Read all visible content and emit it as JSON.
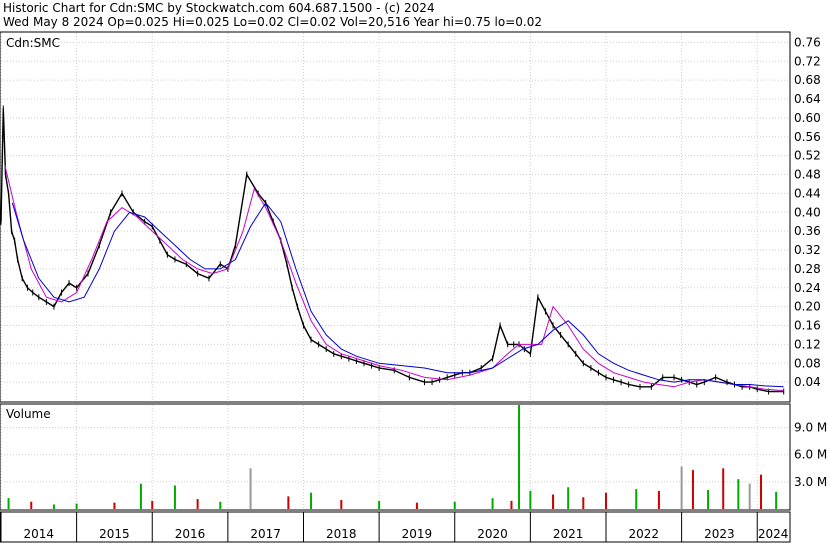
{
  "header": {
    "line1": "Historic Chart for Cdn:SMC by Stockwatch.com 604.687.1500 - (c) 2024",
    "line2": "Wed May  8 2024   Op=0.025  Hi=0.025  Lo=0.02  Cl=0.02  Vol=20,516  Year hi=0.75  lo=0.02"
  },
  "chart_data": [
    {
      "type": "line",
      "panel": "price",
      "title": "Cdn:SMC",
      "ylim": [
        0.0,
        0.78
      ],
      "yticks": [
        "0.76",
        "0.72",
        "0.68",
        "0.64",
        "0.60",
        "0.56",
        "0.52",
        "0.48",
        "0.44",
        "0.40",
        "0.36",
        "0.32",
        "0.28",
        "0.24",
        "0.20",
        "0.16",
        "0.12",
        "0.08",
        "0.04"
      ],
      "grid": true,
      "colors": {
        "price": "#000000",
        "ma_short": "#cc00cc",
        "ma_long": "#0000cc"
      },
      "series": [
        {
          "role": "price",
          "x": [
            2014.0,
            2014.03,
            2014.06,
            2014.1,
            2014.14,
            2014.18,
            2014.22,
            2014.28,
            2014.35,
            2014.42,
            2014.5,
            2014.6,
            2014.7,
            2014.8,
            2014.9,
            2015.0,
            2015.15,
            2015.3,
            2015.45,
            2015.6,
            2015.75,
            2015.9,
            2016.0,
            2016.1,
            2016.2,
            2016.3,
            2016.45,
            2016.6,
            2016.75,
            2016.9,
            2017.0,
            2017.1,
            2017.25,
            2017.4,
            2017.5,
            2017.6,
            2017.7,
            2017.78,
            2017.85,
            2017.92,
            2018.0,
            2018.1,
            2018.2,
            2018.3,
            2018.4,
            2018.5,
            2018.6,
            2018.7,
            2018.8,
            2018.9,
            2019.0,
            2019.2,
            2019.4,
            2019.6,
            2019.7,
            2019.8,
            2019.9,
            2020.0,
            2020.1,
            2020.2,
            2020.35,
            2020.5,
            2020.6,
            2020.7,
            2020.78,
            2020.85,
            2020.92,
            2021.0,
            2021.1,
            2021.2,
            2021.3,
            2021.4,
            2021.5,
            2021.6,
            2021.7,
            2021.8,
            2021.9,
            2022.0,
            2022.1,
            2022.2,
            2022.3,
            2022.45,
            2022.6,
            2022.75,
            2022.9,
            2023.0,
            2023.1,
            2023.2,
            2023.3,
            2023.45,
            2023.6,
            2023.7,
            2023.8,
            2023.9,
            2024.0,
            2024.15,
            2024.35
          ],
          "y": [
            0.38,
            0.62,
            0.48,
            0.44,
            0.36,
            0.34,
            0.3,
            0.26,
            0.24,
            0.23,
            0.22,
            0.21,
            0.2,
            0.23,
            0.25,
            0.24,
            0.27,
            0.33,
            0.4,
            0.44,
            0.4,
            0.38,
            0.37,
            0.34,
            0.31,
            0.3,
            0.29,
            0.27,
            0.26,
            0.29,
            0.28,
            0.33,
            0.48,
            0.44,
            0.42,
            0.38,
            0.34,
            0.29,
            0.24,
            0.2,
            0.16,
            0.13,
            0.12,
            0.11,
            0.1,
            0.095,
            0.09,
            0.085,
            0.08,
            0.075,
            0.07,
            0.065,
            0.05,
            0.04,
            0.04,
            0.045,
            0.05,
            0.055,
            0.06,
            0.06,
            0.07,
            0.09,
            0.16,
            0.12,
            0.12,
            0.12,
            0.11,
            0.1,
            0.22,
            0.19,
            0.16,
            0.14,
            0.12,
            0.1,
            0.08,
            0.07,
            0.06,
            0.05,
            0.045,
            0.04,
            0.035,
            0.03,
            0.03,
            0.05,
            0.05,
            0.045,
            0.04,
            0.035,
            0.04,
            0.05,
            0.04,
            0.035,
            0.03,
            0.03,
            0.025,
            0.02,
            0.02
          ]
        },
        {
          "role": "ma_short",
          "x": [
            2014.05,
            2014.2,
            2014.4,
            2014.6,
            2014.8,
            2015.0,
            2015.2,
            2015.4,
            2015.6,
            2015.8,
            2016.0,
            2016.2,
            2016.4,
            2016.6,
            2016.8,
            2017.0,
            2017.2,
            2017.35,
            2017.5,
            2017.7,
            2017.9,
            2018.1,
            2018.3,
            2018.5,
            2018.8,
            2019.0,
            2019.3,
            2019.6,
            2019.9,
            2020.2,
            2020.5,
            2020.7,
            2020.85,
            2021.0,
            2021.15,
            2021.3,
            2021.5,
            2021.7,
            2021.9,
            2022.1,
            2022.3,
            2022.5,
            2022.7,
            2022.9,
            2023.1,
            2023.3,
            2023.5,
            2023.7,
            2023.9,
            2024.1,
            2024.35
          ],
          "y": [
            0.5,
            0.4,
            0.28,
            0.22,
            0.21,
            0.23,
            0.3,
            0.38,
            0.41,
            0.39,
            0.36,
            0.33,
            0.3,
            0.28,
            0.27,
            0.28,
            0.36,
            0.45,
            0.41,
            0.34,
            0.25,
            0.17,
            0.12,
            0.1,
            0.085,
            0.075,
            0.065,
            0.05,
            0.045,
            0.055,
            0.07,
            0.1,
            0.12,
            0.12,
            0.12,
            0.2,
            0.16,
            0.11,
            0.08,
            0.06,
            0.05,
            0.04,
            0.035,
            0.03,
            0.04,
            0.045,
            0.04,
            0.035,
            0.03,
            0.025,
            0.022
          ]
        },
        {
          "role": "ma_long",
          "x": [
            2014.15,
            2014.3,
            2014.5,
            2014.7,
            2014.9,
            2015.1,
            2015.3,
            2015.5,
            2015.7,
            2015.9,
            2016.1,
            2016.3,
            2016.5,
            2016.7,
            2016.9,
            2017.1,
            2017.3,
            2017.5,
            2017.7,
            2017.9,
            2018.1,
            2018.3,
            2018.5,
            2018.7,
            2019.0,
            2019.3,
            2019.6,
            2019.9,
            2020.2,
            2020.5,
            2020.7,
            2020.9,
            2021.1,
            2021.3,
            2021.5,
            2021.7,
            2021.9,
            2022.1,
            2022.3,
            2022.5,
            2022.7,
            2022.9,
            2023.1,
            2023.3,
            2023.5,
            2023.7,
            2023.9,
            2024.1,
            2024.35
          ],
          "y": [
            0.42,
            0.34,
            0.26,
            0.22,
            0.21,
            0.22,
            0.28,
            0.36,
            0.4,
            0.39,
            0.36,
            0.33,
            0.3,
            0.28,
            0.28,
            0.3,
            0.37,
            0.42,
            0.38,
            0.28,
            0.19,
            0.14,
            0.11,
            0.095,
            0.08,
            0.075,
            0.07,
            0.06,
            0.06,
            0.07,
            0.09,
            0.11,
            0.12,
            0.15,
            0.17,
            0.14,
            0.1,
            0.08,
            0.065,
            0.055,
            0.045,
            0.04,
            0.045,
            0.045,
            0.04,
            0.035,
            0.035,
            0.032,
            0.03
          ]
        }
      ]
    },
    {
      "type": "bar",
      "panel": "volume",
      "title": "Volume",
      "ylim": [
        0,
        11.5
      ],
      "yticks": [
        "9.0 M",
        "6.0 M",
        "3.0 M"
      ],
      "grid": true,
      "colors": {
        "up": "#00aa00",
        "down": "#cc0000",
        "neutral": "#999999"
      },
      "x": [
        2014.1,
        2014.4,
        2014.7,
        2015.0,
        2015.5,
        2015.85,
        2016.0,
        2016.3,
        2016.6,
        2016.9,
        2017.3,
        2017.8,
        2018.1,
        2018.5,
        2019.0,
        2019.5,
        2020.0,
        2020.5,
        2020.75,
        2020.85,
        2021.0,
        2021.3,
        2021.5,
        2021.7,
        2022.0,
        2022.4,
        2022.7,
        2023.0,
        2023.15,
        2023.35,
        2023.55,
        2023.75,
        2023.9,
        2024.05,
        2024.25
      ],
      "values": [
        1.2,
        0.8,
        0.5,
        0.6,
        0.7,
        2.8,
        0.9,
        2.6,
        1.1,
        0.8,
        4.5,
        1.4,
        1.8,
        1.0,
        0.9,
        0.7,
        0.8,
        1.2,
        0.9,
        11.5,
        2.0,
        1.6,
        2.4,
        1.3,
        1.8,
        2.2,
        2.0,
        4.7,
        4.3,
        2.1,
        4.5,
        3.3,
        2.8,
        3.8,
        1.9
      ],
      "direction": [
        "up",
        "down",
        "up",
        "up",
        "down",
        "up",
        "down",
        "up",
        "down",
        "up",
        "neutral",
        "down",
        "up",
        "down",
        "up",
        "down",
        "up",
        "up",
        "down",
        "up",
        "up",
        "down",
        "up",
        "down",
        "down",
        "up",
        "down",
        "neutral",
        "down",
        "up",
        "down",
        "up",
        "neutral",
        "down",
        "up"
      ]
    }
  ],
  "xaxis": {
    "labels": [
      "2014",
      "2015",
      "2016",
      "2017",
      "2018",
      "2019",
      "2020",
      "2021",
      "2022",
      "2023",
      "2024"
    ],
    "years": [
      2014,
      2015,
      2016,
      2017,
      2018,
      2019,
      2020,
      2021,
      2022,
      2023,
      2024
    ]
  }
}
